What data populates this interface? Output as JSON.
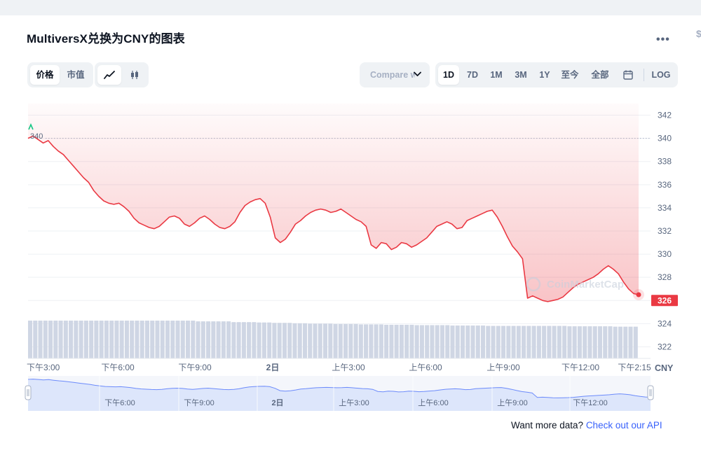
{
  "title": "MultiversX兑换为CNY的图表",
  "more_icon": "more-horizontal-icon",
  "edge_mark": "$",
  "view_toggle": [
    {
      "label": "价格",
      "active": true
    },
    {
      "label": "市值",
      "active": false
    }
  ],
  "chart_style": [
    {
      "icon": "line-chart-icon",
      "active": true
    },
    {
      "icon": "candlestick-icon",
      "active": false
    }
  ],
  "compare": {
    "label": "Compare with",
    "icon": "chevron-down-icon"
  },
  "ranges": [
    {
      "label": "1D",
      "active": true
    },
    {
      "label": "7D",
      "active": false
    },
    {
      "label": "1M",
      "active": false
    },
    {
      "label": "3M",
      "active": false
    },
    {
      "label": "1Y",
      "active": false
    },
    {
      "label": "至今",
      "active": false
    },
    {
      "label": "全部",
      "active": false
    }
  ],
  "calendar_icon": "calendar-icon",
  "log_label": "LOG",
  "watermark": "CoinMarketCap",
  "currency": "CNY",
  "colors": {
    "line": "#ea3943",
    "fill": "#ea3943",
    "volume": "#cfd6e4",
    "navigator": "#dde6fb",
    "navigator_line": "#3861fb",
    "accent": "#3861fb"
  },
  "chart_data": {
    "type": "line",
    "series": [
      {
        "values": [
          340.0,
          340.2,
          339.9,
          339.6,
          339.8,
          339.3,
          338.9,
          338.6,
          338.1,
          337.6,
          337.1,
          336.6,
          336.2,
          335.5,
          335.0,
          334.6,
          334.4,
          334.3,
          334.4,
          334.1,
          333.7,
          333.1,
          332.7,
          332.5,
          332.3,
          332.2,
          332.4,
          332.8,
          333.2,
          333.3,
          333.1,
          332.6,
          332.4,
          332.7,
          333.1,
          333.3,
          333.0,
          332.6,
          332.3,
          332.2,
          332.4,
          332.8,
          333.6,
          334.2,
          334.5,
          334.7,
          334.8,
          334.4,
          333.2,
          331.4,
          331.0,
          331.3,
          331.9,
          332.6,
          332.9,
          333.3,
          333.6,
          333.8,
          333.9,
          333.8,
          333.6,
          333.7,
          333.9,
          333.6,
          333.3,
          333.0,
          332.8,
          332.4,
          330.8,
          330.5,
          331.0,
          330.9,
          330.4,
          330.6,
          331.0,
          330.9,
          330.6,
          330.8,
          331.1,
          331.4,
          331.9,
          332.4,
          332.6,
          332.8,
          332.6,
          332.2,
          332.3,
          332.9,
          333.1,
          333.3,
          333.5,
          333.7,
          333.8,
          333.2,
          332.4,
          331.5,
          330.7,
          330.2,
          329.6,
          326.2,
          326.4,
          326.2,
          326.0,
          325.9,
          326.0,
          326.1,
          326.3,
          326.7,
          327.1,
          327.4,
          327.6,
          327.8,
          328.0,
          328.3,
          328.7,
          329.0,
          328.7,
          328.3,
          327.6,
          327.0,
          326.6,
          326.5
        ],
        "last": 326
      }
    ],
    "y_ticks": [
      342,
      340,
      338,
      336,
      334,
      332,
      330,
      328,
      326,
      324,
      322
    ],
    "ylim": [
      321,
      343
    ],
    "start_label": "340",
    "last_label": "326",
    "x_ticks": [
      "下午3:00",
      "下午6:00",
      "下午9:00",
      "2日",
      "上午3:00",
      "上午6:00",
      "上午9:00",
      "下午12:00",
      "下午2:15"
    ],
    "volume": [
      10,
      10,
      10,
      10,
      10,
      10,
      10,
      10,
      10,
      10,
      10,
      10,
      10,
      10,
      10,
      10,
      10,
      10,
      10,
      10,
      10,
      10,
      10,
      10,
      10,
      10,
      10,
      10,
      10,
      10,
      10,
      10,
      10,
      9.8,
      9.8,
      9.8,
      9.8,
      9.8,
      9.8,
      9.8,
      9.6,
      9.6,
      9.6,
      9.6,
      9.6,
      9.5,
      9.5,
      9.5,
      9.4,
      9.4,
      9.4,
      9.4,
      9.3,
      9.3,
      9.3,
      9.2,
      9.2,
      9.2,
      9.2,
      9.2,
      9.1,
      9.1,
      9.1,
      9.1,
      9.1,
      9.0,
      9.0,
      9.0,
      9.0,
      9.0,
      8.9,
      8.9,
      8.9,
      8.9,
      8.9,
      8.9,
      8.8,
      8.8,
      8.8,
      8.8,
      8.8,
      8.8,
      8.8,
      8.7,
      8.7,
      8.7,
      8.7,
      8.7,
      8.7,
      8.7,
      8.6,
      8.6,
      8.6,
      8.6,
      8.6,
      8.6,
      8.6,
      8.6,
      8.6,
      8.6,
      8.6,
      8.6,
      8.6,
      8.6,
      8.6,
      8.6,
      8.5,
      8.5,
      8.5,
      8.5,
      8.5,
      8.5,
      8.5,
      8.5,
      8.5,
      8.4,
      8.4,
      8.4,
      8.4,
      8.4
    ],
    "navigator_ticks": [
      "下午6:00",
      "下午9:00",
      "2日",
      "上午3:00",
      "上午6:00",
      "上午9:00",
      "下午12:00"
    ]
  },
  "api": {
    "prefix": "Want more data? ",
    "link": "Check out our API"
  }
}
